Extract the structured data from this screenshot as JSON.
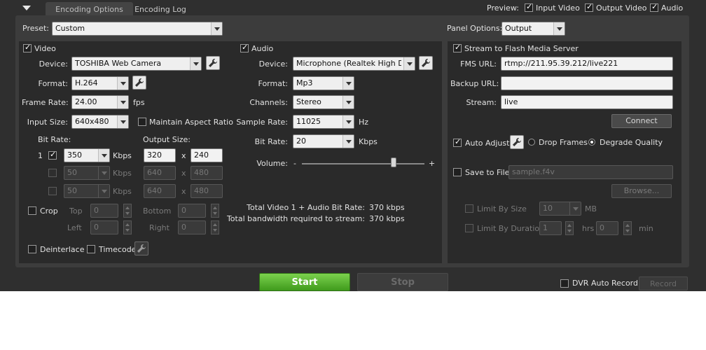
{
  "top": {
    "tabs": [
      {
        "label": "Encoding Options"
      },
      {
        "label": "Encoding Log"
      }
    ],
    "preview_label": "Preview:",
    "preview_options": [
      {
        "label": "Input Video"
      },
      {
        "label": "Output Video"
      },
      {
        "label": "Audio"
      }
    ]
  },
  "preset": {
    "label": "Preset:",
    "value": "Custom"
  },
  "panel_options": {
    "label": "Panel Options:",
    "value": "Output"
  },
  "video": {
    "title": "Video",
    "device_label": "Device:",
    "device": "TOSHIBA Web Camera",
    "format_label": "Format:",
    "format": "H.264",
    "frame_rate_label": "Frame Rate:",
    "frame_rate": "24.00",
    "frame_rate_unit": "fps",
    "input_size_label": "Input Size:",
    "input_size": "640x480",
    "maintain_aspect": "Maintain Aspect Ratio",
    "bit_rate_label": "Bit Rate:",
    "output_size_label": "Output Size:",
    "rows": [
      {
        "index": "1",
        "bitrate": "350",
        "unit": "Kbps",
        "width": "320",
        "x": "x",
        "height": "240"
      },
      {
        "bitrate": "50",
        "unit": "Kbps",
        "width": "640",
        "x": "x",
        "height": "480"
      },
      {
        "bitrate": "50",
        "unit": "Kbps",
        "width": "640",
        "x": "x",
        "height": "480"
      }
    ],
    "crop": "Crop",
    "top": "Top",
    "bottom": "Bottom",
    "left": "Left",
    "right": "Right",
    "crop_top": "0",
    "crop_bottom": "0",
    "crop_left": "0",
    "crop_right": "0",
    "deinterlace": "Deinterlace",
    "timecode": "Timecode"
  },
  "audio": {
    "title": "Audio",
    "device_label": "Device:",
    "device": "Microphone (Realtek High Defin",
    "format_label": "Format:",
    "format": "Mp3",
    "channels_label": "Channels:",
    "channels": "Stereo",
    "sample_rate_label": "Sample Rate:",
    "sample_rate": "11025",
    "sample_rate_unit": "Hz",
    "bit_rate_label": "Bit Rate:",
    "bit_rate": "20",
    "bit_rate_unit": "Kbps",
    "volume_label": "Volume:",
    "volume_minus": "-",
    "volume_plus": "+",
    "volume_level": 0.75
  },
  "totals": {
    "total_label": "Total Video 1 + Audio Bit Rate:",
    "total_value": "370 kbps",
    "bandwidth_label": "Total bandwidth required to stream:",
    "bandwidth_value": "370 kbps"
  },
  "output": {
    "stream_to_fms": "Stream to Flash Media Server",
    "fms_url_label": "FMS URL:",
    "fms_url": "rtmp://211.95.39.212/live221",
    "backup_url_label": "Backup URL:",
    "backup_url": "",
    "stream_label": "Stream:",
    "stream": "live",
    "connect": "Connect",
    "auto_adjust": "Auto Adjust",
    "drop_frames": "Drop Frames",
    "degrade_quality": "Degrade Quality",
    "save_to_file": "Save to File",
    "file_name": "sample.f4v",
    "browse": "Browse...",
    "limit_by_size": "Limit By Size",
    "limit_size": "10",
    "limit_size_unit": "MB",
    "limit_by_duration": "Limit By Duration",
    "duration_hrs": "1",
    "hrs": "hrs",
    "duration_min": "0",
    "min": "min"
  },
  "bottom": {
    "start": "Start",
    "stop": "Stop",
    "dvr_auto_record": "DVR Auto Record",
    "record": "Record"
  }
}
